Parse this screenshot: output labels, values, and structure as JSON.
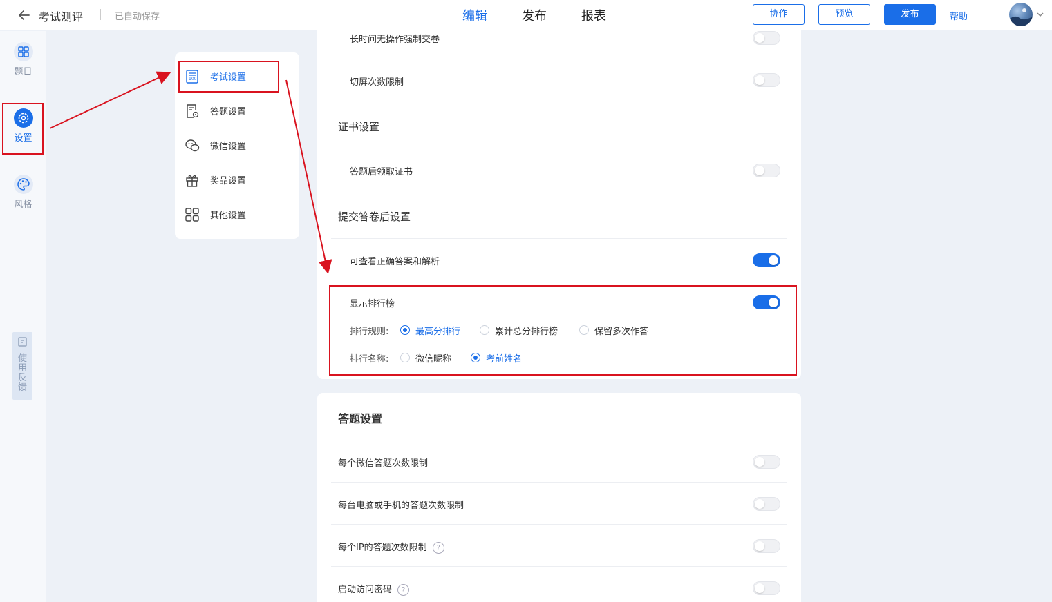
{
  "topbar": {
    "title": "考试测评",
    "autosave": "已自动保存",
    "tabs": [
      "编辑",
      "发布",
      "报表"
    ],
    "buttons": {
      "collab": "协作",
      "preview": "预览",
      "publish": "发布"
    },
    "help": "帮助"
  },
  "sidebar": {
    "items": [
      {
        "label": "题目",
        "icon": "grid-icon"
      },
      {
        "label": "设置",
        "icon": "gear-icon",
        "active": true
      },
      {
        "label": "风格",
        "icon": "palette-icon"
      }
    ],
    "feedback": "使用反馈"
  },
  "submenu": {
    "items": [
      {
        "label": "考试设置",
        "icon": "exam-sheet-icon",
        "active": true
      },
      {
        "label": "答题设置",
        "icon": "answer-settings-icon"
      },
      {
        "label": "微信设置",
        "icon": "wechat-icon"
      },
      {
        "label": "奖品设置",
        "icon": "gift-icon"
      },
      {
        "label": "其他设置",
        "icon": "apps-icon"
      }
    ]
  },
  "exam_panel": {
    "rows": [
      {
        "label": "长时间无操作强制交卷",
        "on": false
      },
      {
        "label": "切屏次数限制",
        "on": false
      }
    ],
    "cert_section": "证书设置",
    "cert_row": {
      "label": "答题后领取证书",
      "on": false
    },
    "submit_section": "提交答卷后设置",
    "answer_row": {
      "label": "可查看正确答案和解析",
      "on": true
    },
    "ranking": {
      "label": "显示排行榜",
      "on": true,
      "rule_label": "排行规则:",
      "rule_options": [
        "最高分排行",
        "累计总分排行榜",
        "保留多次作答"
      ],
      "rule_selected": "最高分排行",
      "name_label": "排行名称:",
      "name_options": [
        "微信昵称",
        "考前姓名"
      ],
      "name_selected": "考前姓名"
    }
  },
  "answer_panel": {
    "title": "答题设置",
    "rows": [
      {
        "label": "每个微信答题次数限制",
        "on": false
      },
      {
        "label": "每台电脑或手机的答题次数限制",
        "on": false
      },
      {
        "label": "每个IP的答题次数限制",
        "on": false,
        "help": "?"
      },
      {
        "label": "启动访问密码",
        "on": false,
        "help": "?"
      }
    ]
  },
  "colors": {
    "accent": "#1a6ee8",
    "annotation": "#d9131f",
    "background": "#edf1f7"
  }
}
